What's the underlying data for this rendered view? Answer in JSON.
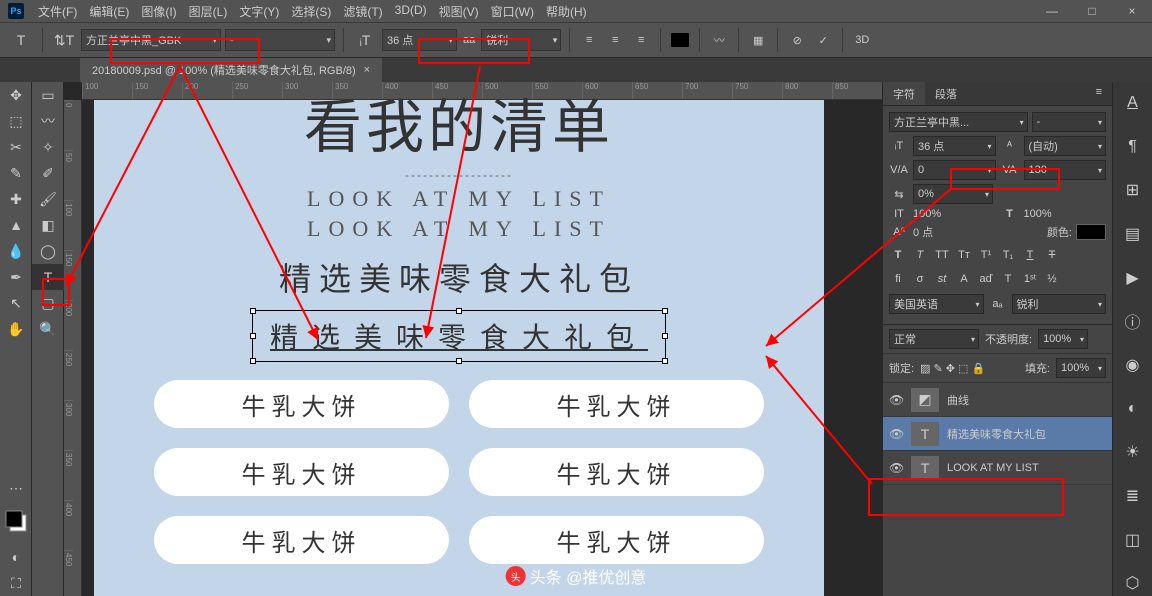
{
  "menu": [
    "文件(F)",
    "编辑(E)",
    "图像(I)",
    "图层(L)",
    "文字(Y)",
    "选择(S)",
    "滤镜(T)",
    "3D(D)",
    "视图(V)",
    "窗口(W)",
    "帮助(H)"
  ],
  "opt": {
    "font": "方正兰亭中黑_GBK",
    "style": "-",
    "size": "36 点",
    "aa": "锐利",
    "label_aa": "aa"
  },
  "tab": {
    "title": "20180009.psd @ 100% (精选美味零食大礼包, RGB/8)",
    "close": "×"
  },
  "ruler_h": [
    "100",
    "150",
    "200",
    "250",
    "300",
    "350",
    "400",
    "450",
    "500",
    "550",
    "600",
    "650",
    "700",
    "750",
    "800",
    "850"
  ],
  "ruler_v": [
    "0",
    "50",
    "100",
    "150",
    "200",
    "250",
    "300",
    "350",
    "400",
    "450"
  ],
  "doc": {
    "title": "看我的清单",
    "dash": "------------------",
    "en1": "LOOK AT MY LIST",
    "en2": "LOOK AT MY LIST",
    "sub": "精选美味零食大礼包",
    "sel": "精选美味零食大礼包",
    "pills": [
      "牛乳大饼",
      "牛乳大饼",
      "牛乳大饼",
      "牛乳大饼",
      "牛乳大饼",
      "牛乳大饼"
    ]
  },
  "char": {
    "tab1": "字符",
    "tab2": "段落",
    "font": "方正兰亭中黑...",
    "style": "-",
    "size": "36 点",
    "leading": "(自动)",
    "va": "0",
    "tracking": "130",
    "scale": "0%",
    "h": "100%",
    "v": "100%",
    "baseline": "0 点",
    "color_label": "颜色:",
    "lang": "美国英语",
    "aa": "锐利"
  },
  "layers": {
    "mode": "正常",
    "opacity_l": "不透明度:",
    "opacity": "100%",
    "lock_l": "锁定:",
    "fill_l": "填充:",
    "fill": "100%",
    "items": [
      {
        "name": "曲线",
        "type": "adj"
      },
      {
        "name": "精选美味零食大礼包",
        "type": "T",
        "sel": true
      },
      {
        "name": "LOOK AT MY LIST",
        "type": "T"
      }
    ]
  },
  "watermark": "头条 @推优创意"
}
